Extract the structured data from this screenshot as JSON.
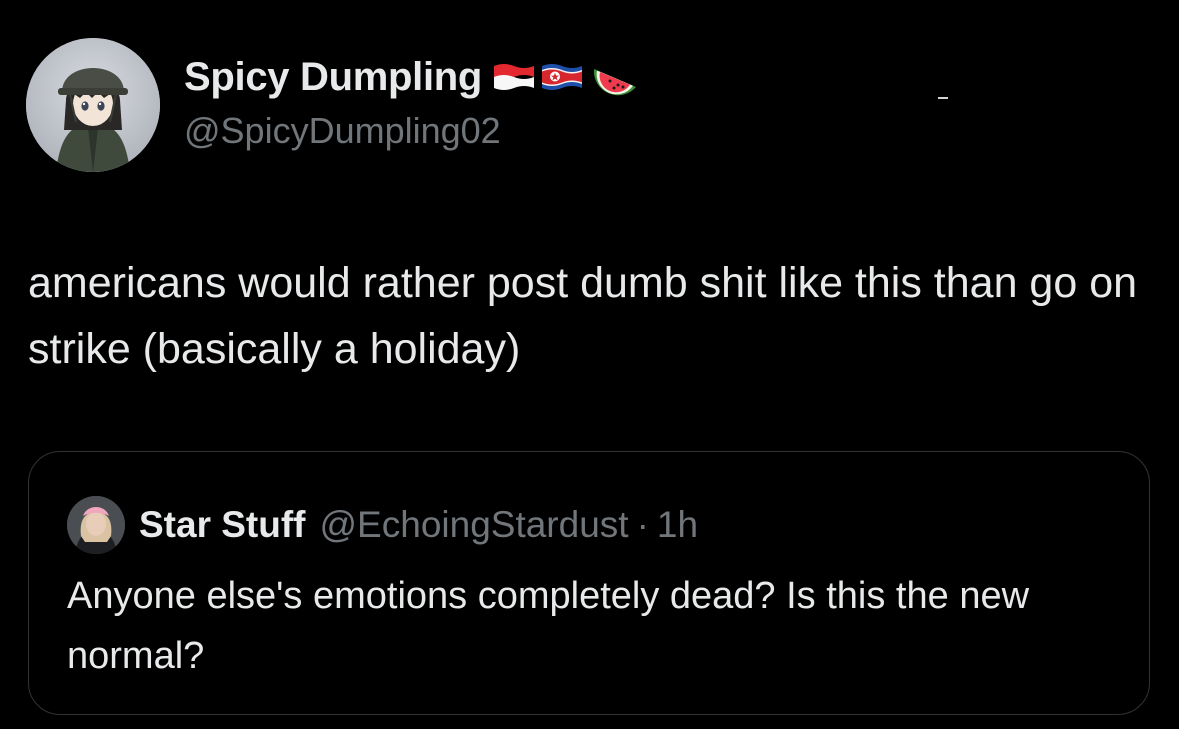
{
  "tweet": {
    "author": {
      "display_name": "Spicy Dumpling",
      "handle": "@SpicyDumpling02",
      "avatar_icon": "anime-girl-avatar",
      "name_emojis": [
        "indonesia-flag-icon",
        "north-korea-flag-icon",
        "watermelon-icon"
      ]
    },
    "text": "americans would rather post dumb shit like this than go on strike (basically a holiday)"
  },
  "quote": {
    "author": {
      "display_name": "Star Stuff",
      "handle": "@EchoingStardust",
      "separator": "·",
      "time": "1h",
      "avatar_icon": "user-photo-avatar"
    },
    "text": "Anyone else's emotions completely dead? Is this the new normal?"
  },
  "colors": {
    "background": "#000000",
    "primary_text": "#e7e9ea",
    "secondary_text": "#71767b",
    "card_border": "#2f3336"
  }
}
